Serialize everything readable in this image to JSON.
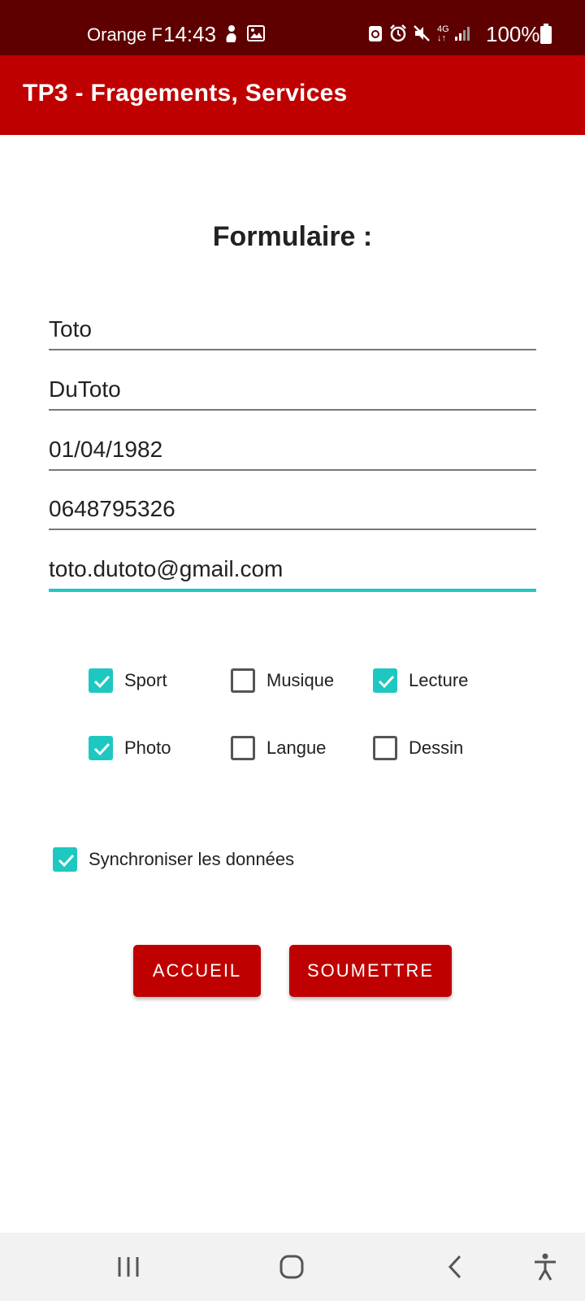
{
  "status_bar": {
    "carrier": "Orange F",
    "time": "14:43",
    "battery": "100%",
    "network": "4G",
    "icons": [
      "figure-icon",
      "image-icon",
      "recycle-icon",
      "alarm-icon",
      "mute-icon",
      "network-4g-icon",
      "signal-icon",
      "battery-icon"
    ]
  },
  "app_bar": {
    "title": "TP3 - Fragements, Services"
  },
  "form": {
    "title": "Formulaire :",
    "fields": [
      {
        "value": "Toto"
      },
      {
        "value": "DuToto"
      },
      {
        "value": "01/04/1982"
      },
      {
        "value": "0648795326"
      },
      {
        "value": "toto.dutoto@gmail.com",
        "focused": true
      }
    ],
    "interests": [
      {
        "label": "Sport",
        "checked": true
      },
      {
        "label": "Musique",
        "checked": false
      },
      {
        "label": "Lecture",
        "checked": true
      },
      {
        "label": "Photo",
        "checked": true
      },
      {
        "label": "Langue",
        "checked": false
      },
      {
        "label": "Dessin",
        "checked": false
      }
    ],
    "sync": {
      "label": "Synchroniser les données",
      "checked": true
    }
  },
  "buttons": {
    "home": "ACCUEIL",
    "submit": "SOUMETTRE"
  },
  "colors": {
    "status_bar": "#5e0000",
    "app_bar": "#bf0000",
    "accent": "#1ec8c0",
    "button": "#bf0000"
  },
  "nav_bar": {
    "icons": [
      "recent-apps-icon",
      "home-icon",
      "back-icon",
      "accessibility-icon"
    ]
  }
}
